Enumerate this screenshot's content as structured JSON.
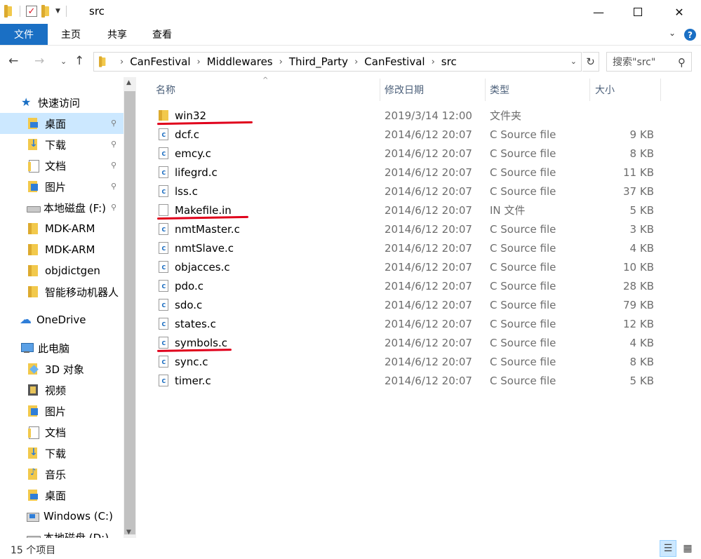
{
  "window": {
    "title": "src",
    "minimize": "—",
    "close": "✕"
  },
  "ribbon": {
    "tabs": [
      "文件",
      "主页",
      "共享",
      "查看"
    ],
    "collapse": "⌄",
    "help": "?"
  },
  "nav": {
    "back": "←",
    "forward": "→",
    "history": "⌄",
    "up": "↑"
  },
  "address": {
    "crumbs": [
      "CanFestival",
      "Middlewares",
      "Third_Party",
      "CanFestival",
      "src"
    ],
    "separator": "›",
    "dropdown": "⌄",
    "refresh": "↻"
  },
  "search": {
    "placeholder": "搜索\"src\"",
    "icon": "search-icon"
  },
  "sidebar": {
    "items": [
      {
        "label": "快速访问",
        "icon": "star-icon",
        "pinned": false
      },
      {
        "label": "桌面",
        "icon": "desktop-folder-icon",
        "pinned": true,
        "selected": true
      },
      {
        "label": "下载",
        "icon": "downloads-folder-icon",
        "pinned": true
      },
      {
        "label": "文档",
        "icon": "documents-folder-icon",
        "pinned": true
      },
      {
        "label": "图片",
        "icon": "pictures-folder-icon",
        "pinned": true
      },
      {
        "label": "本地磁盘 (F:)",
        "icon": "drive-icon",
        "pinned": true
      },
      {
        "label": "MDK-ARM",
        "icon": "folder-icon",
        "pinned": false
      },
      {
        "label": "MDK-ARM",
        "icon": "folder-icon",
        "pinned": false
      },
      {
        "label": "objdictgen",
        "icon": "folder-icon",
        "pinned": false
      },
      {
        "label": "智能移动机器人",
        "icon": "folder-icon",
        "pinned": false
      },
      {
        "label": "OneDrive",
        "icon": "cloud-icon",
        "pinned": false
      },
      {
        "label": "此电脑",
        "icon": "computer-icon",
        "pinned": false
      },
      {
        "label": "3D 对象",
        "icon": "3d-objects-icon",
        "pinned": false
      },
      {
        "label": "视频",
        "icon": "videos-icon",
        "pinned": false
      },
      {
        "label": "图片",
        "icon": "pictures-folder-icon",
        "pinned": false
      },
      {
        "label": "文档",
        "icon": "documents-folder-icon",
        "pinned": false
      },
      {
        "label": "下载",
        "icon": "downloads-folder-icon",
        "pinned": false
      },
      {
        "label": "音乐",
        "icon": "music-icon",
        "pinned": false
      },
      {
        "label": "桌面",
        "icon": "desktop-folder-icon",
        "pinned": false
      },
      {
        "label": "Windows (C:)",
        "icon": "windows-drive-icon",
        "pinned": false
      },
      {
        "label": "本地磁盘 (D:)",
        "icon": "drive-icon",
        "pinned": false
      }
    ],
    "pin_glyph": "📌"
  },
  "filelist": {
    "columns": {
      "name": "名称",
      "date": "修改日期",
      "type": "类型",
      "size": "大小"
    },
    "sort_caret": "^",
    "rows": [
      {
        "name": "win32",
        "date": "2019/3/14 12:00",
        "type": "文件夹",
        "size": "",
        "icon": "folder-icon",
        "underlined": true
      },
      {
        "name": "dcf.c",
        "date": "2014/6/12 20:07",
        "type": "C Source file",
        "size": "9 KB",
        "icon": "c-file-icon"
      },
      {
        "name": "emcy.c",
        "date": "2014/6/12 20:07",
        "type": "C Source file",
        "size": "8 KB",
        "icon": "c-file-icon"
      },
      {
        "name": "lifegrd.c",
        "date": "2014/6/12 20:07",
        "type": "C Source file",
        "size": "11 KB",
        "icon": "c-file-icon"
      },
      {
        "name": "lss.c",
        "date": "2014/6/12 20:07",
        "type": "C Source file",
        "size": "37 KB",
        "icon": "c-file-icon"
      },
      {
        "name": "Makefile.in",
        "date": "2014/6/12 20:07",
        "type": "IN 文件",
        "size": "5 KB",
        "icon": "file-icon",
        "underlined": true
      },
      {
        "name": "nmtMaster.c",
        "date": "2014/6/12 20:07",
        "type": "C Source file",
        "size": "3 KB",
        "icon": "c-file-icon"
      },
      {
        "name": "nmtSlave.c",
        "date": "2014/6/12 20:07",
        "type": "C Source file",
        "size": "4 KB",
        "icon": "c-file-icon"
      },
      {
        "name": "objacces.c",
        "date": "2014/6/12 20:07",
        "type": "C Source file",
        "size": "10 KB",
        "icon": "c-file-icon"
      },
      {
        "name": "pdo.c",
        "date": "2014/6/12 20:07",
        "type": "C Source file",
        "size": "28 KB",
        "icon": "c-file-icon"
      },
      {
        "name": "sdo.c",
        "date": "2014/6/12 20:07",
        "type": "C Source file",
        "size": "79 KB",
        "icon": "c-file-icon"
      },
      {
        "name": "states.c",
        "date": "2014/6/12 20:07",
        "type": "C Source file",
        "size": "12 KB",
        "icon": "c-file-icon"
      },
      {
        "name": "symbols.c",
        "date": "2014/6/12 20:07",
        "type": "C Source file",
        "size": "4 KB",
        "icon": "c-file-icon",
        "underlined": true
      },
      {
        "name": "sync.c",
        "date": "2014/6/12 20:07",
        "type": "C Source file",
        "size": "8 KB",
        "icon": "c-file-icon"
      },
      {
        "name": "timer.c",
        "date": "2014/6/12 20:07",
        "type": "C Source file",
        "size": "5 KB",
        "icon": "c-file-icon"
      }
    ]
  },
  "annotation_color": "#e0001b",
  "accent_color": "#1a6fc4",
  "statusbar": {
    "count_text": "15 个项目",
    "details_view_icon": "details-view-icon",
    "large_icons_view_icon": "large-icons-view-icon"
  }
}
